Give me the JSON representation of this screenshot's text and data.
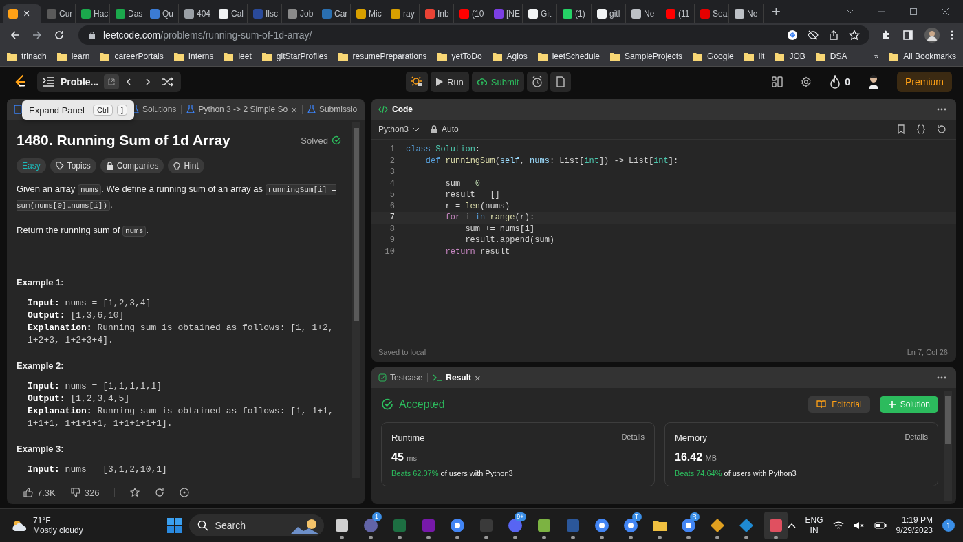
{
  "browser": {
    "tabs": [
      {
        "selected": true,
        "color": "#ffa116",
        "close": "×"
      },
      {
        "label": "Cur",
        "selected": false,
        "color": "#5a5a5a"
      },
      {
        "label": "Hac",
        "selected": false,
        "color": "#1ba94c"
      },
      {
        "label": "Das",
        "selected": false,
        "color": "#1ba94c"
      },
      {
        "label": "Qu",
        "selected": false,
        "color": "#3b7bd4"
      },
      {
        "label": "404",
        "selected": false,
        "color": "#9aa0a6"
      },
      {
        "label": "Cal",
        "selected": false,
        "color": "#f1f3f4"
      },
      {
        "label": "Ilsc",
        "selected": false,
        "color": "#2a4a9a"
      },
      {
        "label": "Job",
        "selected": false,
        "color": "#8a8a8a"
      },
      {
        "label": "Car",
        "selected": false,
        "color": "#2a6fb0"
      },
      {
        "label": "Mic",
        "selected": false,
        "color": "#d8a000"
      },
      {
        "label": "ray",
        "selected": false,
        "color": "#d8a000"
      },
      {
        "label": "Inb",
        "selected": false,
        "color": "#ea4335"
      },
      {
        "label": "(10",
        "selected": false,
        "color": "#ff0000"
      },
      {
        "label": "[NE",
        "selected": false,
        "color": "#7b3fe4"
      },
      {
        "label": "Git",
        "selected": false,
        "color": "#f1f3f4"
      },
      {
        "label": "(1)",
        "selected": false,
        "color": "#25d366"
      },
      {
        "label": "gitl",
        "selected": false,
        "color": "#f1f3f4"
      },
      {
        "label": "Ne",
        "selected": false,
        "color": "#bdc1c6"
      },
      {
        "label": "(11",
        "selected": false,
        "color": "#ff0000"
      },
      {
        "label": "Sea",
        "selected": false,
        "color": "#e60000"
      },
      {
        "label": "Ne",
        "selected": false,
        "color": "#bdc1c6"
      }
    ],
    "new_tab": "+",
    "url": {
      "host": "leetcode.com",
      "path": "/problems/running-sum-of-1d-array/"
    },
    "bookmarks": [
      "trinadh",
      "learn",
      "careerPortals",
      "Interns",
      "leet",
      "gitStarProfiles",
      "resumePreparations",
      "yetToDo",
      "Aglos",
      "leetSchedule",
      "SampleProjects",
      "Google",
      "iit",
      "JOB",
      "DSA"
    ],
    "more_bookmarks": "»",
    "all_bookmarks": "All Bookmarks"
  },
  "header": {
    "problem_list": "Proble...",
    "run": "Run",
    "submit": "Submit",
    "streak": "0",
    "premium": "Premium"
  },
  "left_panel": {
    "tabs": [
      {
        "label": "Solutions",
        "selected": false
      },
      {
        "label": "Python 3 -> 2 Simple So",
        "selected": false,
        "close": "×"
      },
      {
        "label": "Submissio",
        "selected": false
      }
    ],
    "tooltip": {
      "label": "Expand Panel",
      "keys": [
        "Ctrl",
        "]"
      ]
    },
    "title": "1480. Running Sum of 1d Array",
    "status": "Solved",
    "tags": [
      {
        "label": "Easy",
        "kind": "difficulty"
      },
      {
        "label": "Topics",
        "kind": "tag"
      },
      {
        "label": "Companies",
        "kind": "lock"
      },
      {
        "label": "Hint",
        "kind": "bulb"
      }
    ],
    "paragraphs": [
      [
        {
          "kind": "text",
          "text": "Given an array "
        },
        {
          "kind": "code",
          "text": "nums"
        },
        {
          "kind": "text",
          "text": ". We define a running sum of an array as "
        },
        {
          "kind": "code",
          "text": "runningSum[i] = sum(nums[0]…nums[i])"
        },
        {
          "kind": "text",
          "text": "."
        }
      ],
      [
        {
          "kind": "text",
          "text": "Return the running sum of "
        },
        {
          "kind": "code",
          "text": "nums"
        },
        {
          "kind": "text",
          "text": "."
        }
      ]
    ],
    "examples": [
      {
        "title": "Example 1:",
        "lines": [
          {
            "label": "Input:",
            "value": "nums = [1,2,3,4]"
          },
          {
            "label": "Output:",
            "value": "[1,3,6,10]"
          },
          {
            "label": "Explanation:",
            "value": "Running sum is obtained as follows: [1, 1+2, 1+2+3, 1+2+3+4]."
          }
        ]
      },
      {
        "title": "Example 2:",
        "lines": [
          {
            "label": "Input:",
            "value": "nums = [1,1,1,1,1]"
          },
          {
            "label": "Output:",
            "value": "[1,2,3,4,5]"
          },
          {
            "label": "Explanation:",
            "value": "Running sum is obtained as follows: [1, 1+1, 1+1+1, 1+1+1+1, 1+1+1+1+1]."
          }
        ]
      },
      {
        "title": "Example 3:",
        "lines": [
          {
            "label": "Input:",
            "value": "nums = [3,1,2,10,1]"
          }
        ]
      }
    ],
    "likes": "7.3K",
    "dislikes": "326"
  },
  "code_panel": {
    "title": "Code",
    "language": "Python3",
    "mode": "Auto",
    "lines": [
      {
        "n": "1",
        "current": false,
        "tokens": [
          {
            "kind": "kw",
            "text": "class"
          },
          {
            "kind": "cls",
            "text": " Solution"
          },
          {
            "kind": "p",
            "text": ":"
          }
        ]
      },
      {
        "n": "2",
        "current": false,
        "tokens": [
          {
            "kind": "kw",
            "text": "    def"
          },
          {
            "kind": "fn",
            "text": " runningSum"
          },
          {
            "kind": "p",
            "text": "("
          },
          {
            "kind": "var",
            "text": "self"
          },
          {
            "kind": "p",
            "text": ", "
          },
          {
            "kind": "var",
            "text": "nums"
          },
          {
            "kind": "p",
            "text": ": List["
          },
          {
            "kind": "cls",
            "text": "int"
          },
          {
            "kind": "p",
            "text": "]) -> List["
          },
          {
            "kind": "cls",
            "text": "int"
          },
          {
            "kind": "p",
            "text": "]:"
          }
        ]
      },
      {
        "n": "3",
        "current": false
      },
      {
        "n": "4",
        "current": false,
        "tokens": [
          {
            "kind": "p",
            "text": "        sum = "
          },
          {
            "kind": "num",
            "text": "0"
          }
        ]
      },
      {
        "n": "5",
        "current": false,
        "tokens": [
          {
            "kind": "p",
            "text": "        result = []"
          }
        ]
      },
      {
        "n": "6",
        "current": false,
        "tokens": [
          {
            "kind": "p",
            "text": "        r = "
          },
          {
            "kind": "fn",
            "text": "len"
          },
          {
            "kind": "p",
            "text": "(nums)"
          }
        ]
      },
      {
        "n": "7",
        "current": true,
        "tokens": [
          {
            "kind": "ctl",
            "text": "        for"
          },
          {
            "kind": "p",
            "text": " i "
          },
          {
            "kind": "kw",
            "text": "in"
          },
          {
            "kind": "fn",
            "text": " range"
          },
          {
            "kind": "p",
            "text": "(r):"
          }
        ]
      },
      {
        "n": "8",
        "current": false,
        "tokens": [
          {
            "kind": "p",
            "text": "            sum += nums[i]"
          }
        ]
      },
      {
        "n": "9",
        "current": false,
        "tokens": [
          {
            "kind": "p",
            "text": "            result.append(sum)"
          }
        ]
      },
      {
        "n": "10",
        "current": false,
        "tokens": [
          {
            "kind": "ctl",
            "text": "        return"
          },
          {
            "kind": "p",
            "text": " result"
          }
        ]
      }
    ],
    "saved": "Saved to local",
    "cursor": "Ln 7, Col 26"
  },
  "result_panel": {
    "tabs": [
      {
        "label": "Testcase",
        "selected": false
      },
      {
        "label": "Result",
        "selected": true,
        "close": "×"
      }
    ],
    "status": "Accepted",
    "editorial": "Editorial",
    "solution": "Solution",
    "cards": [
      {
        "title": "Runtime",
        "details": "Details",
        "value": "45",
        "unit": "ms",
        "beats": "Beats 62.07%",
        "suffix": "of users with Python3"
      },
      {
        "title": "Memory",
        "details": "Details",
        "value": "16.42",
        "unit": "MB",
        "beats": "Beats 74.64%",
        "suffix": "of users with Python3"
      }
    ]
  },
  "taskbar": {
    "temperature": "71°F",
    "weather": "Mostly cloudy",
    "search": "Search",
    "apps": [
      {
        "kind": "windows",
        "color": "#d0d0d0",
        "active": false
      },
      {
        "kind": "teams",
        "color": "#6264a7",
        "active": false,
        "badge": "1"
      },
      {
        "kind": "excel",
        "color": "#1d6f42",
        "active": false
      },
      {
        "kind": "onenote",
        "color": "#7719aa",
        "active": false
      },
      {
        "kind": "chrome",
        "color": "#4285f4",
        "active": false
      },
      {
        "kind": "terminal",
        "color": "#3a3a3a",
        "active": false
      },
      {
        "kind": "discord",
        "color": "#5865f2",
        "active": false,
        "badge": "9+"
      },
      {
        "kind": "notepad",
        "color": "#7cb342",
        "active": false
      },
      {
        "kind": "word",
        "color": "#2b579a",
        "active": false
      },
      {
        "kind": "chrome",
        "color": "#4285f4",
        "active": false
      },
      {
        "kind": "chrome",
        "color": "#4285f4",
        "active": false,
        "badge": "T"
      },
      {
        "kind": "folder",
        "color": "#f0c040",
        "active": false
      },
      {
        "kind": "chrome",
        "color": "#4285f4",
        "active": false,
        "badge": "R"
      },
      {
        "kind": "git",
        "color": "#e0a020",
        "active": false
      },
      {
        "kind": "vscode",
        "color": "#1f8ad2",
        "active": false
      },
      {
        "kind": "snip",
        "color": "#e05060",
        "active": true
      }
    ],
    "lang": "ENG",
    "region": "IN",
    "time": "1:19 PM",
    "date": "9/29/2023",
    "notifications": "1"
  }
}
